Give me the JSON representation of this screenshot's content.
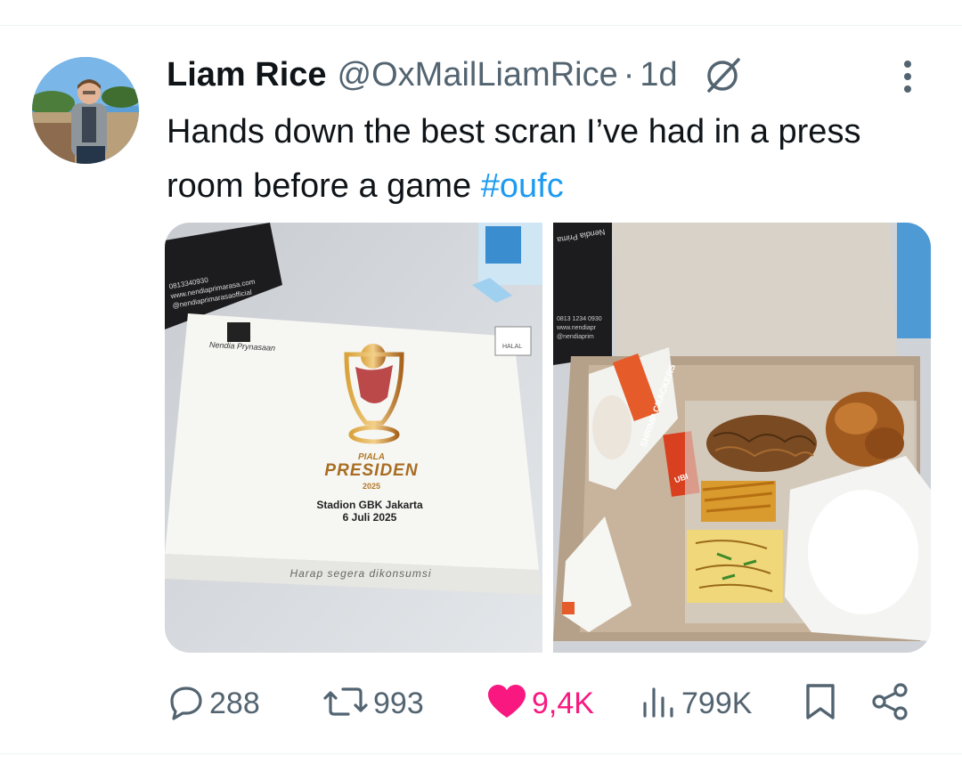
{
  "tweet": {
    "author_name": "Liam Rice",
    "handle": "@OxMailLiamRice",
    "separator": "·",
    "time": "1d",
    "text_main": "Hands down the best scran I’ve had in a press room before a game ",
    "hashtag": "#oufc"
  },
  "photo_box": {
    "brand_name": "Nendia Prynasaan",
    "corner_badge": "HALAL",
    "event_small": "PIALA",
    "event_big": "PRESIDEN",
    "event_year": "2025",
    "venue": "Stadion GBK Jakarta",
    "date": "6 Juli 2025",
    "footer_note": "Harap segera dikonsumsi",
    "left_box_lines": [
      "0813340930",
      "www.nendiaprimarasa.com",
      "@nendiaprimarasaofficial"
    ]
  },
  "photo_meal": {
    "cracker_pack": "SHRIMP CRACKERS",
    "sauce_pack": "UBI",
    "lid_text": "Nendia Prima",
    "lid_lines": [
      "0813 1234 0930",
      "www.nendiapr",
      "@nendiaprim"
    ]
  },
  "actions": {
    "replies": "288",
    "retweets": "993",
    "likes": "9,4K",
    "views": "799K"
  },
  "colors": {
    "text_primary": "#0f1419",
    "text_secondary": "#536471",
    "link": "#1d9bf0",
    "like": "#f91880",
    "divider": "#eff3f4"
  },
  "icons": [
    "grok-icon",
    "more-icon",
    "reply-icon",
    "retweet-icon",
    "like-icon",
    "views-icon",
    "bookmark-icon",
    "share-icon"
  ]
}
